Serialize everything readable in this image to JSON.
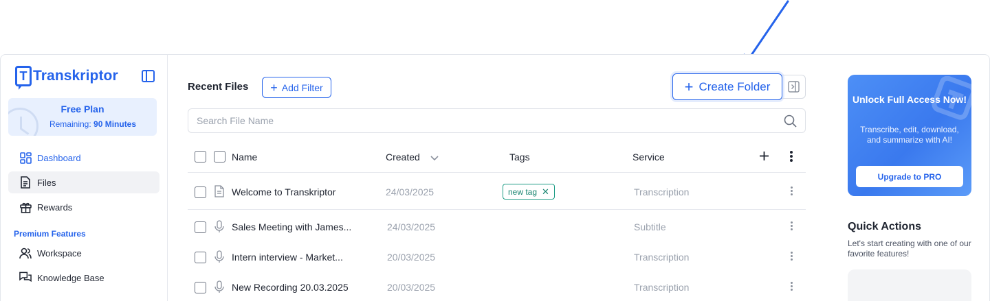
{
  "brand": {
    "name": "Transkriptor",
    "mark": "T"
  },
  "colors": {
    "accent": "#2563eb",
    "tag": "#1a9a83",
    "muted": "#9aa1ad"
  },
  "plan": {
    "title": "Free Plan",
    "remaining_label": "Remaining:",
    "remaining_value": "90 Minutes"
  },
  "nav": [
    {
      "label": "Dashboard",
      "icon": "dashboard-grid-icon"
    },
    {
      "label": "Files",
      "icon": "file-icon"
    },
    {
      "label": "Rewards",
      "icon": "gift-icon"
    }
  ],
  "premium": {
    "label": "Premium Features",
    "items": [
      {
        "label": "Workspace",
        "icon": "users-icon"
      },
      {
        "label": "Knowledge Base",
        "icon": "chat-bubbles-icon"
      }
    ]
  },
  "main": {
    "title": "Recent Files",
    "add_filter": "Add Filter",
    "create_folder": "Create Folder",
    "search_placeholder": "Search File Name",
    "columns": {
      "name": "Name",
      "created": "Created",
      "tags": "Tags",
      "service": "Service"
    },
    "rows": [
      {
        "name": "Welcome to Transkriptor",
        "created": "24/03/2025",
        "tag": "new tag",
        "service": "Transcription",
        "icon": "document-icon"
      },
      {
        "name": "Sales Meeting with James...",
        "created": "24/03/2025",
        "tag": "",
        "service": "Subtitle",
        "icon": "microphone-icon"
      },
      {
        "name": "Intern interview - Market...",
        "created": "20/03/2025",
        "tag": "",
        "service": "Transcription",
        "icon": "microphone-icon"
      },
      {
        "name": "New Recording 20.03.2025",
        "created": "20/03/2025",
        "tag": "",
        "service": "Transcription",
        "icon": "microphone-icon"
      }
    ]
  },
  "promo": {
    "title": "Unlock Full Access Now!",
    "text": "Transcribe, edit, download, and summarize with AI!",
    "button": "Upgrade to PRO"
  },
  "quick_actions": {
    "title": "Quick Actions",
    "subtitle": "Let's start creating with one of our favorite features!"
  }
}
